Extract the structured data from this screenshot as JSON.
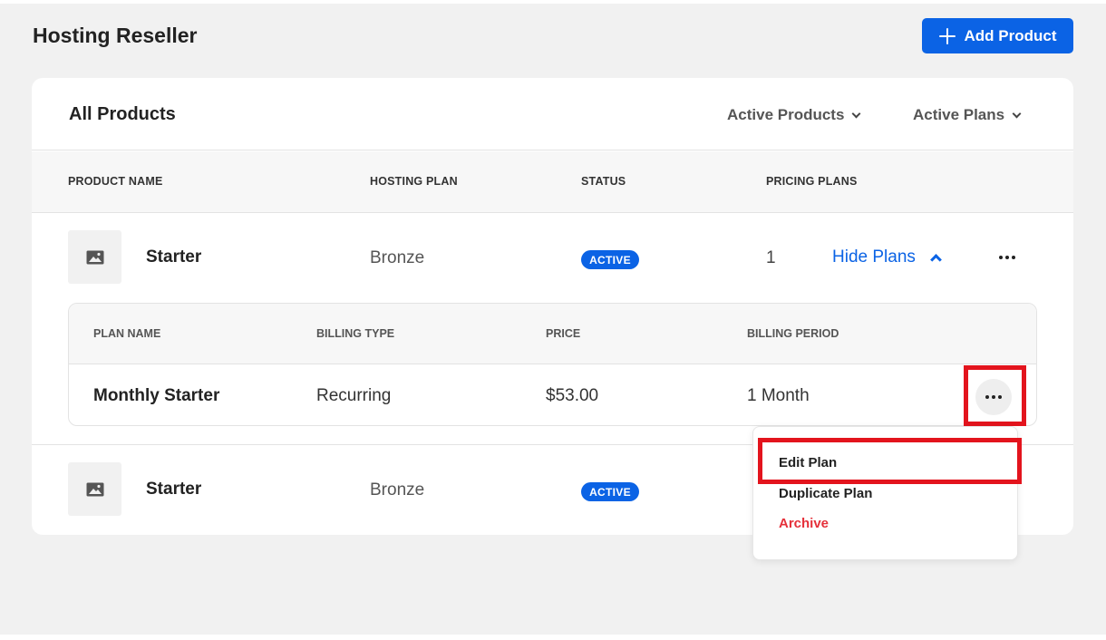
{
  "header": {
    "title": "Hosting Reseller",
    "add_product_label": "Add Product"
  },
  "card": {
    "title": "All Products",
    "filters": [
      {
        "label": "Active Products"
      },
      {
        "label": "Active Plans"
      }
    ],
    "columns": {
      "product_name": "PRODUCT NAME",
      "hosting_plan": "HOSTING PLAN",
      "status": "STATUS",
      "pricing_plans": "PRICING PLANS"
    },
    "products": [
      {
        "name": "Starter",
        "hosting_plan": "Bronze",
        "status": "ACTIVE",
        "pricing_plans_count": "1",
        "toggle_label": "Hide Plans"
      },
      {
        "name": "Starter",
        "hosting_plan": "Bronze",
        "status": "ACTIVE"
      }
    ],
    "plans_table": {
      "columns": {
        "plan_name": "PLAN NAME",
        "billing_type": "BILLING TYPE",
        "price": "PRICE",
        "billing_period": "BILLING PERIOD"
      },
      "rows": [
        {
          "plan_name": "Monthly Starter",
          "billing_type": "Recurring",
          "price": "$53.00",
          "billing_period": "1 Month"
        }
      ]
    }
  },
  "plan_menu": {
    "items": [
      {
        "label": "Edit Plan"
      },
      {
        "label": "Duplicate Plan"
      },
      {
        "label": "Archive"
      }
    ]
  },
  "colors": {
    "accent": "#0b63e5",
    "highlight": "#e3141d",
    "danger": "#e5303a",
    "background": "#f1f1f1"
  },
  "icons": [
    "plus-icon",
    "image-placeholder-icon",
    "chevron-down-icon",
    "chevron-up-icon",
    "more-horizontal-icon"
  ]
}
